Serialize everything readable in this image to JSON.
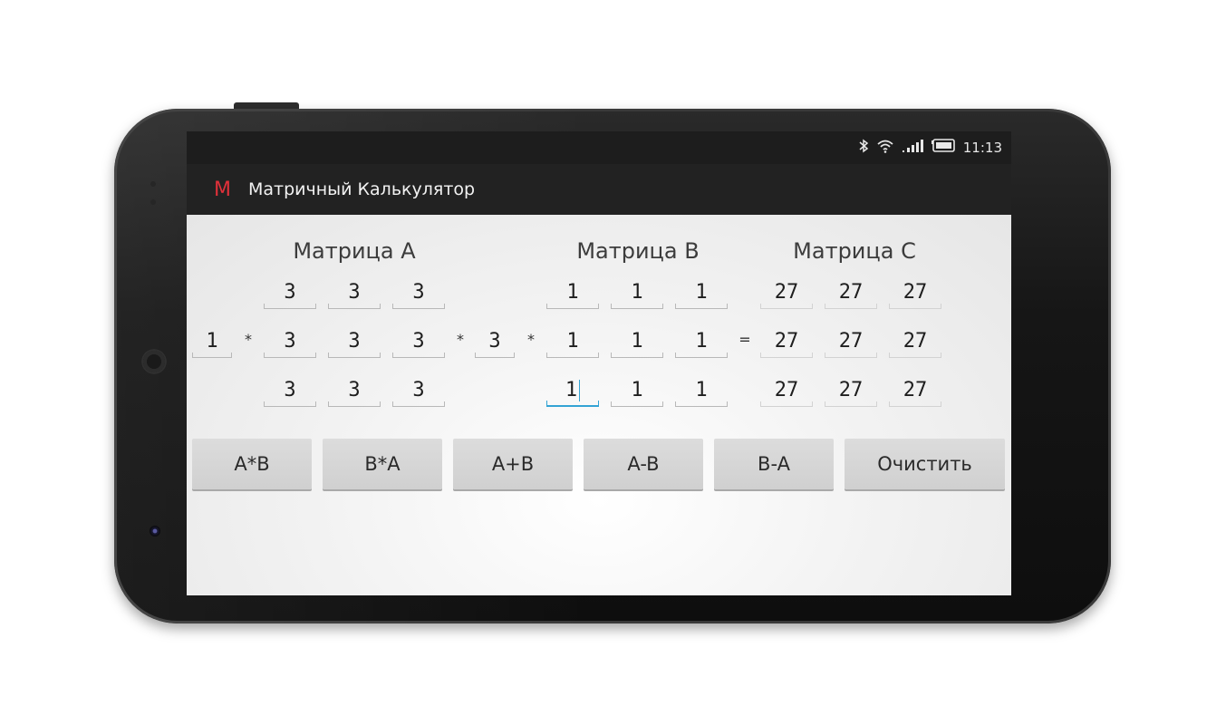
{
  "status_bar": {
    "time": "11:13",
    "icons": [
      "bluetooth-icon",
      "wifi-icon",
      "signal-icon",
      "battery-icon"
    ]
  },
  "app": {
    "icon_letter": "M",
    "title": "Матричный Калькулятор",
    "accent_color": "#e0313a"
  },
  "matrices": {
    "a": {
      "title": "Матрица A",
      "rows": [
        [
          "3",
          "3",
          "3"
        ],
        [
          "3",
          "3",
          "3"
        ],
        [
          "3",
          "3",
          "3"
        ]
      ]
    },
    "b": {
      "title": "Матрица B",
      "rows": [
        [
          "1",
          "1",
          "1"
        ],
        [
          "1",
          "1",
          "1"
        ],
        [
          "1",
          "1",
          "1"
        ]
      ]
    },
    "c": {
      "title": "Матрица C",
      "rows": [
        [
          "27",
          "27",
          "27"
        ],
        [
          "27",
          "27",
          "27"
        ],
        [
          "27",
          "27",
          "27"
        ]
      ]
    }
  },
  "scalars": {
    "a_coefficient": "1",
    "b_coefficient": "3"
  },
  "operators": {
    "mul": "*",
    "eq": "="
  },
  "buttons": {
    "a_mul_b": "A*B",
    "b_mul_a": "B*A",
    "a_plus_b": "A+B",
    "a_minus_b": "A-B",
    "b_minus_a": "B-A",
    "clear": "Очистить"
  },
  "focus_color": "#33a3d4"
}
